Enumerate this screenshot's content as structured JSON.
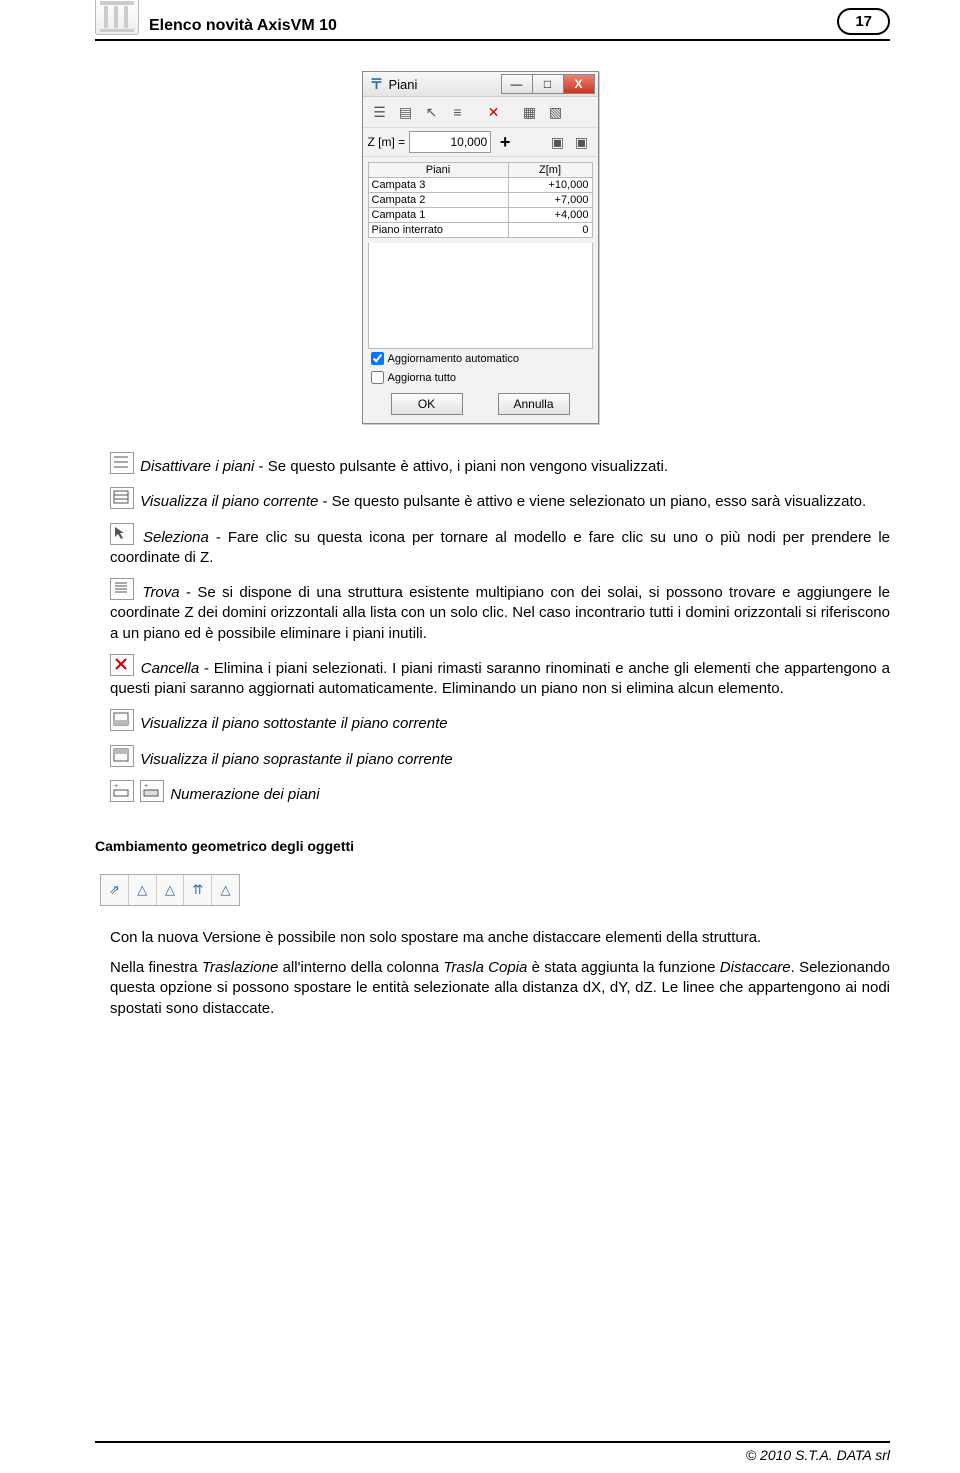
{
  "header": {
    "title": "Elenco novità AxisVM 10",
    "page": "17"
  },
  "dialog": {
    "title": "Piani",
    "z_label": "Z [m] =",
    "z_value": "10,000",
    "columns": [
      "Piani",
      "Z[m]"
    ],
    "rows": [
      {
        "name": "Campata 3",
        "z": "+10,000"
      },
      {
        "name": "Campata 2",
        "z": "+7,000"
      },
      {
        "name": "Campata 1",
        "z": "+4,000"
      },
      {
        "name": "Piano interrato",
        "z": "0"
      }
    ],
    "check1": "Aggiornamento automatico",
    "check2": "Aggiorna tutto",
    "ok": "OK",
    "cancel": "Annulla"
  },
  "text": {
    "p1a": "Disattivare i piani",
    "p1b": " - Se questo pulsante è attivo, i piani non vengono visualizzati.",
    "p2a": "Visualizza il piano corrente",
    "p2b": " - Se questo pulsante è attivo e viene selezionato un piano, esso sarà visualizzato.",
    "p3a": "Seleziona",
    "p3b": " - Fare clic su questa icona per tornare al modello e fare clic su uno o più nodi per prendere le coordinate di Z.",
    "p4a": "Trova",
    "p4b": " - Se si dispone di una struttura esistente multipiano con dei solai, si possono trovare e aggiungere le coordinate Z dei domini orizzontali alla lista con un solo clic. Nel caso incontrario tutti i domini orizzontali si riferiscono a un piano ed è possibile eliminare i piani inutili.",
    "p5a": "Cancella",
    "p5b": " - Elimina i piani selezionati. I piani rimasti saranno rinominati e anche gli elementi che appartengono a questi piani saranno aggiornati automaticamente. Eliminando un piano non si elimina alcun elemento.",
    "p6": "Visualizza il piano sottostante il piano corrente",
    "p7": "Visualizza il piano soprastante il piano corrente",
    "p8": "Numerazione dei piani"
  },
  "section2": {
    "title": "Cambiamento geometrico degli oggetti",
    "p1": "Con la nuova Versione è possibile non solo spostare ma anche distaccare elementi della struttura.",
    "p2a": "Nella finestra ",
    "p2b": "Traslazione",
    "p2c": " all'interno della colonna ",
    "p2d": "Trasla Copia",
    "p2e": " è stata aggiunta la funzione ",
    "p2f": "Distaccare",
    "p2g": ". Selezionando questa opzione si possono spostare le entità selezionate alla distanza dX, dY, dZ. Le linee che appartengono ai nodi spostati sono distaccate."
  },
  "footer": "© 2010 S.T.A. DATA srl"
}
